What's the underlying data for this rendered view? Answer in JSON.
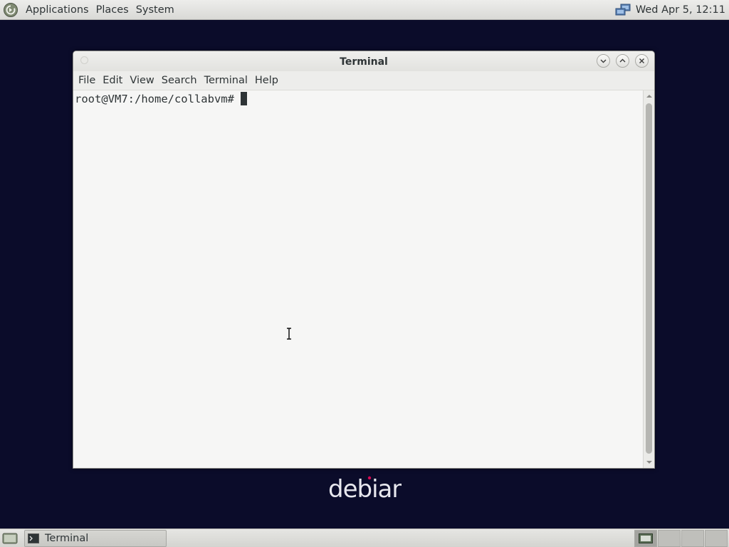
{
  "top_panel": {
    "menus": [
      "Applications",
      "Places",
      "System"
    ],
    "clock": "Wed Apr  5, 12:11",
    "icons": [
      "debian-swirl-icon",
      "network-icon"
    ]
  },
  "desktop": {
    "watermark": "debian"
  },
  "terminal": {
    "title": "Terminal",
    "menu": [
      "File",
      "Edit",
      "View",
      "Search",
      "Terminal",
      "Help"
    ],
    "prompt": "root@VM7:/home/collabvm#",
    "window_buttons": [
      "minimize-icon",
      "maximize-icon",
      "close-icon"
    ]
  },
  "bottom_panel": {
    "task_label": "Terminal",
    "workspaces": 4,
    "active_workspace": 1
  },
  "colors": {
    "desktop_bg": "#0b0c2a",
    "panel_bg": "#e6e6e3",
    "terminal_bg": "#f6f6f5",
    "text": "#2e3436",
    "debian_red": "#d70a53"
  }
}
